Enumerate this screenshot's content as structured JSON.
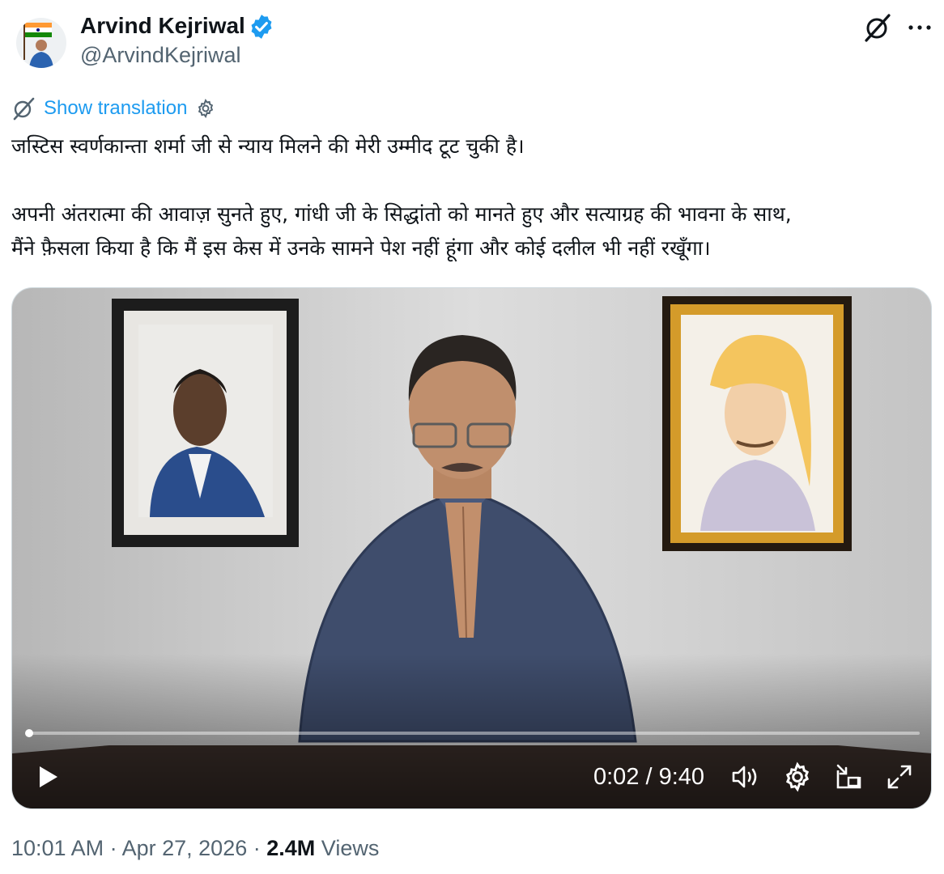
{
  "author": {
    "display_name": "Arvind Kejriwal",
    "handle": "@ArvindKejriwal",
    "verified": true,
    "avatar_icon": "avatar-with-flag"
  },
  "header_icons": [
    "grok-icon",
    "more-options-icon"
  ],
  "translation": {
    "label": "Show translation",
    "icons": [
      "grok-translate-icon",
      "settings-icon"
    ]
  },
  "tweet": {
    "paragraphs": [
      "जस्टिस स्वर्णकान्ता शर्मा जी से न्याय मिलने की मेरी उम्मीद टूट चुकी है।",
      "अपनी अंतरात्मा की आवाज़ सुनते हुए, गांधी जी के सिद्धांतो को मानते हुए और सत्याग्रह की भावना के साथ,",
      "मैंने फ़ैसला किया है कि मैं इस केस में उनके सामने पेश नहीं हूंगा और कोई दलील भी नहीं रखूँगा।"
    ]
  },
  "video": {
    "current_time": "0:02",
    "duration": "9:40",
    "time_display": "0:02 / 9:40",
    "progress_fraction": 0.0034,
    "controls": [
      "play-icon",
      "volume-icon",
      "settings-icon",
      "dock-icon",
      "fullscreen-icon"
    ]
  },
  "meta": {
    "time": "10:01 AM",
    "date": "Apr 27, 2026",
    "views_count": "2.4M",
    "views_label": "Views"
  },
  "colors": {
    "accent": "#1d9bf0",
    "text_primary": "#0f1419",
    "text_secondary": "#536471"
  }
}
